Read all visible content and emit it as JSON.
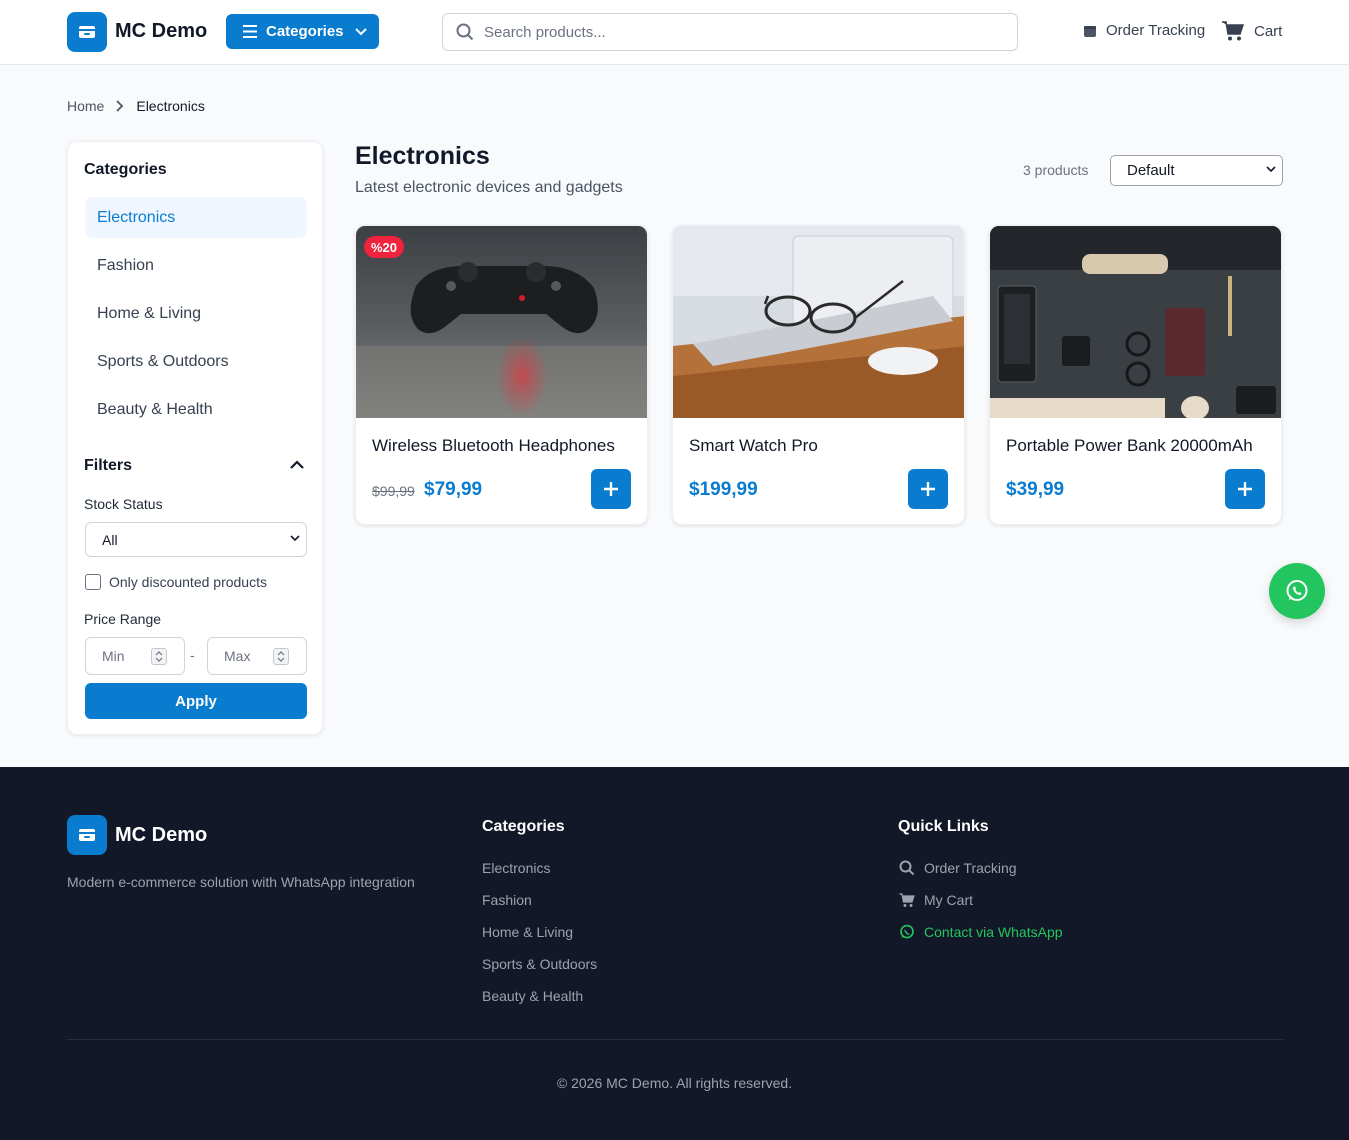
{
  "header": {
    "logo_text": "MC Demo",
    "categories_label": "Categories",
    "search_placeholder": "Search products...",
    "order_tracking": "Order Tracking",
    "cart": "Cart"
  },
  "breadcrumb": {
    "home": "Home",
    "current": "Electronics"
  },
  "sidebar": {
    "title": "Categories",
    "items": [
      {
        "label": "Electronics",
        "active": true
      },
      {
        "label": "Fashion"
      },
      {
        "label": "Home & Living"
      },
      {
        "label": "Sports & Outdoors"
      },
      {
        "label": "Beauty & Health"
      }
    ],
    "filters_title": "Filters",
    "stock_label": "Stock Status",
    "stock_value": "All",
    "discount_label": "Only discounted products",
    "price_label": "Price Range",
    "min_placeholder": "Min",
    "max_placeholder": "Max",
    "dash": "-",
    "apply": "Apply"
  },
  "main": {
    "title": "Electronics",
    "subtitle": "Latest electronic devices and gadgets",
    "count": "3 products",
    "sort_value": "Default",
    "products": [
      {
        "name": "Wireless Bluetooth Headphones",
        "old_price": "$99,99",
        "price": "$79,99",
        "badge": "%20"
      },
      {
        "name": "Smart Watch Pro",
        "price": "$199,99"
      },
      {
        "name": "Portable Power Bank 20000mAh",
        "price": "$39,99"
      }
    ]
  },
  "footer": {
    "logo_text": "MC Demo",
    "tagline": "Modern e-commerce solution with WhatsApp integration",
    "categories_head": "Categories",
    "categories": [
      "Electronics",
      "Fashion",
      "Home & Living",
      "Sports & Outdoors",
      "Beauty & Health"
    ],
    "quick_head": "Quick Links",
    "quick": [
      "Order Tracking",
      "My Cart",
      "Contact via WhatsApp"
    ],
    "copyright": "© 2026 MC Demo. All rights reserved."
  },
  "colors": {
    "brand": "#0a7ccf",
    "whatsapp": "#22c55e",
    "badge": "#ef233c",
    "footer_bg": "#121827"
  }
}
